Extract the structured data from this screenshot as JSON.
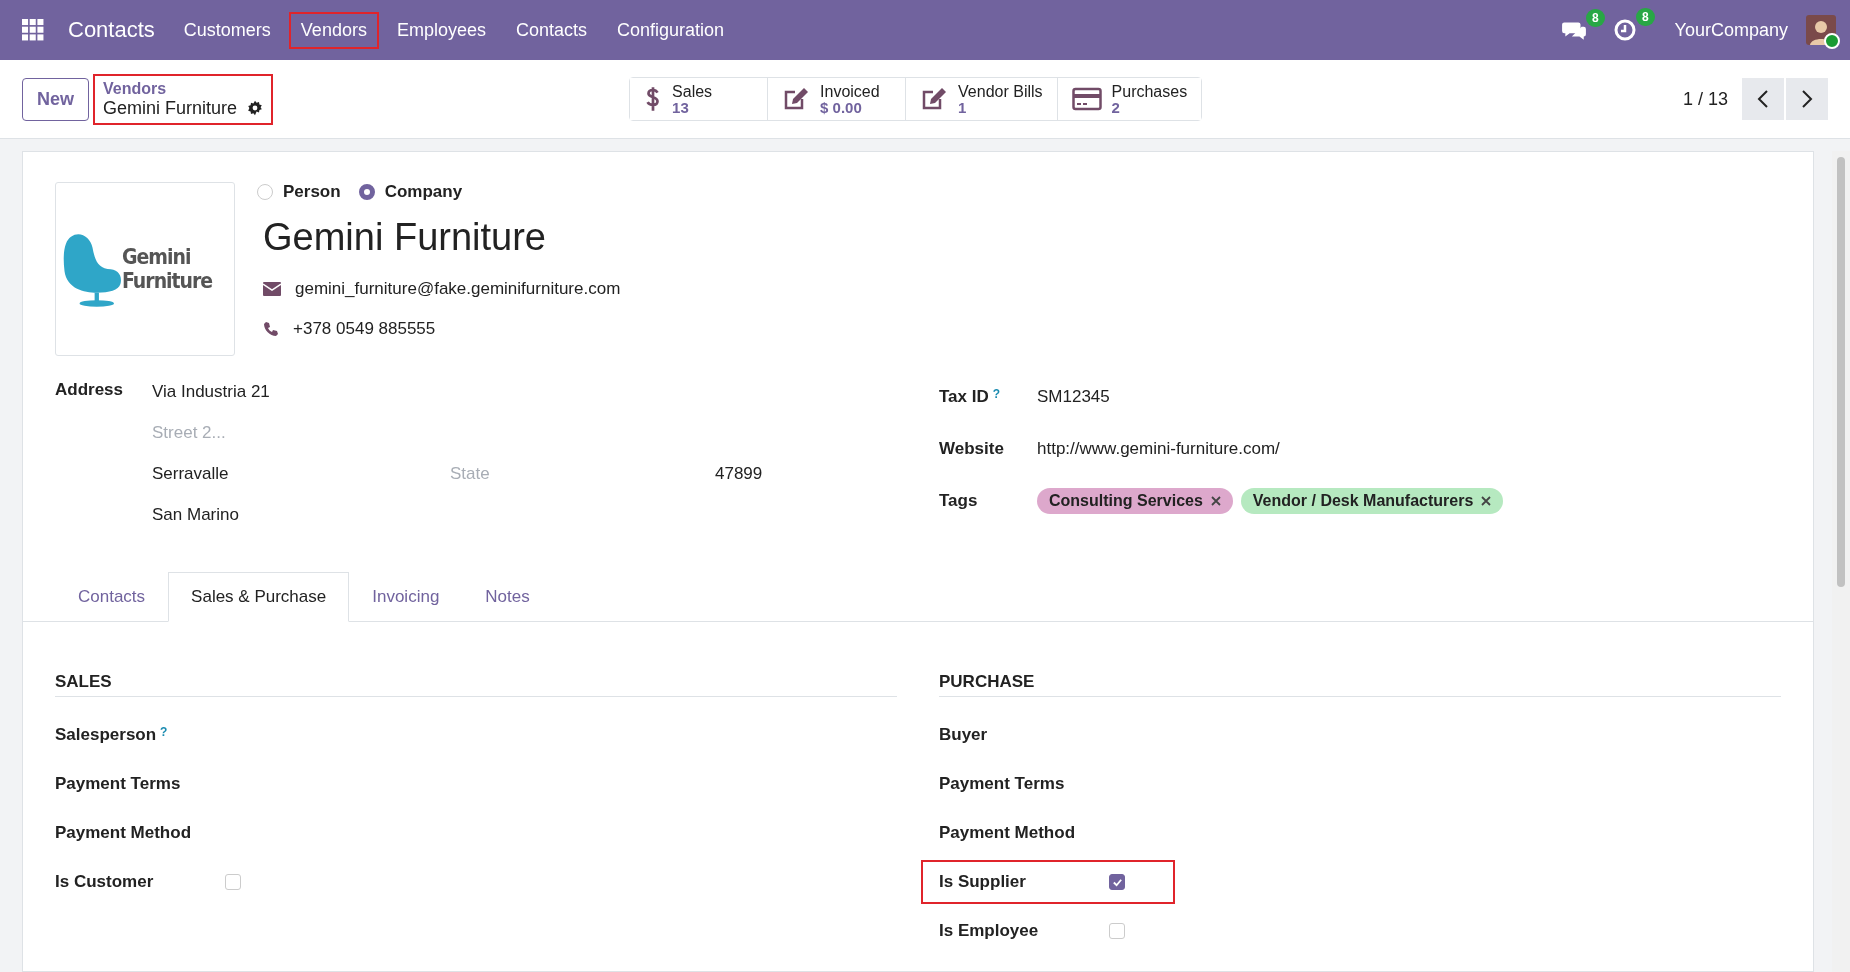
{
  "navbar": {
    "app_name": "Contacts",
    "menu": [
      {
        "label": "Customers",
        "highlighted": false
      },
      {
        "label": "Vendors",
        "highlighted": true
      },
      {
        "label": "Employees",
        "highlighted": false
      },
      {
        "label": "Contacts",
        "highlighted": false
      },
      {
        "label": "Configuration",
        "highlighted": false
      }
    ],
    "messages_badge": "8",
    "activities_badge": "8",
    "company": "YourCompany"
  },
  "control_panel": {
    "new_button": "New",
    "breadcrumb": {
      "parent": "Vendors",
      "current": "Gemini Furniture",
      "highlighted": true
    },
    "stat_buttons": [
      {
        "kind": "dollar",
        "label": "Sales",
        "value": "13"
      },
      {
        "kind": "edit",
        "label": "Invoiced",
        "value": "$ 0.00"
      },
      {
        "kind": "edit",
        "label": "Vendor Bills",
        "value": "1"
      },
      {
        "kind": "card",
        "label": "Purchases",
        "value": "2"
      }
    ],
    "pager": "1 / 13"
  },
  "form": {
    "company_type": [
      {
        "label": "Person",
        "selected": false
      },
      {
        "label": "Company",
        "selected": true
      }
    ],
    "logo_text": [
      "Gemini",
      "Furniture"
    ],
    "name": "Gemini Furniture",
    "email": "gemini_furniture@fake.geminifurniture.com",
    "phone": "+378 0549 885555",
    "address": {
      "label": "Address",
      "street": "Via Industria 21",
      "street2_placeholder": "Street 2...",
      "city": "Serravalle",
      "state_placeholder": "State",
      "zip": "47899",
      "country": "San Marino"
    },
    "tax_id": {
      "label": "Tax ID",
      "help": "?",
      "value": "SM12345"
    },
    "website": {
      "label": "Website",
      "value": "http://www.gemini-furniture.com/"
    },
    "tags": {
      "label": "Tags",
      "items": [
        {
          "label": "Consulting Services",
          "color": "#dda8cc"
        },
        {
          "label": "Vendor / Desk Manufacturers",
          "color": "#b6e9c0"
        }
      ]
    },
    "tabs": [
      {
        "label": "Contacts",
        "selected": false
      },
      {
        "label": "Sales & Purchase",
        "selected": true
      },
      {
        "label": "Invoicing",
        "selected": false
      },
      {
        "label": "Notes",
        "selected": false
      }
    ],
    "sections": [
      {
        "title": "SALES",
        "fields": [
          {
            "kind": "text",
            "label": "Salesperson",
            "help": "?",
            "highlighted": false
          },
          {
            "kind": "text",
            "label": "Payment Terms",
            "highlighted": false
          },
          {
            "kind": "text",
            "label": "Payment Method",
            "highlighted": false
          },
          {
            "kind": "checkbox",
            "label": "Is Customer",
            "checked": false,
            "highlighted": false
          }
        ]
      },
      {
        "title": "PURCHASE",
        "fields": [
          {
            "kind": "text",
            "label": "Buyer",
            "highlighted": false
          },
          {
            "kind": "text",
            "label": "Payment Terms",
            "highlighted": false
          },
          {
            "kind": "text",
            "label": "Payment Method",
            "highlighted": false
          },
          {
            "kind": "checkbox",
            "label": "Is Supplier",
            "checked": true,
            "highlighted": true
          },
          {
            "kind": "checkbox",
            "label": "Is Employee",
            "checked": false,
            "highlighted": false
          }
        ]
      }
    ]
  }
}
